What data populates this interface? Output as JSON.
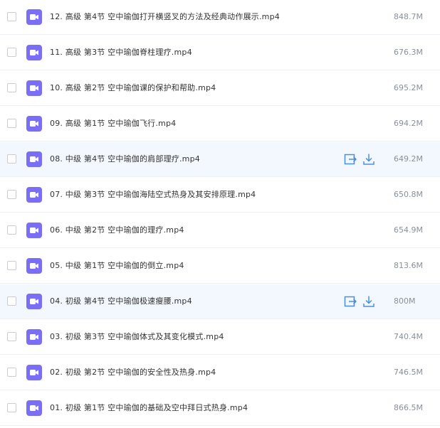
{
  "files": [
    {
      "name": "12. 高级 第4节 空中瑜伽打开横竖叉的方法及经典动作展示.mp4",
      "size": "848.7M",
      "hovered": false,
      "icon": "video-file-icon"
    },
    {
      "name": "11. 高级 第3节 空中瑜伽脊柱理疗.mp4",
      "size": "676.3M",
      "hovered": false,
      "icon": "video-file-icon"
    },
    {
      "name": "10. 高级 第2节 空中瑜伽课的保护和帮助.mp4",
      "size": "695.2M",
      "hovered": false,
      "icon": "video-file-icon"
    },
    {
      "name": "09. 高级 第1节 空中瑜伽飞行.mp4",
      "size": "694.2M",
      "hovered": false,
      "icon": "video-file-icon"
    },
    {
      "name": "08. 中级 第4节 空中瑜伽的肩部理疗.mp4",
      "size": "649.2M",
      "hovered": true,
      "icon": "video-file-icon"
    },
    {
      "name": "07. 中级 第3节 空中瑜伽海陆空式热身及其安排原理.mp4",
      "size": "650.8M",
      "hovered": false,
      "icon": "video-file-icon"
    },
    {
      "name": "06. 中级 第2节 空中瑜伽的理疗.mp4",
      "size": "654.9M",
      "hovered": false,
      "icon": "video-file-icon"
    },
    {
      "name": "05. 中级 第1节 空中瑜伽的倒立.mp4",
      "size": "813.6M",
      "hovered": false,
      "icon": "video-file-icon"
    },
    {
      "name": "04. 初级 第4节 空中瑜伽极速瘦腰.mp4",
      "size": "800M",
      "hovered": true,
      "icon": "video-file-icon"
    },
    {
      "name": "03. 初级 第3节 空中瑜伽体式及其变化模式.mp4",
      "size": "740.4M",
      "hovered": false,
      "icon": "video-file-icon"
    },
    {
      "name": "02. 初级 第2节 空中瑜伽的安全性及热身.mp4",
      "size": "746.5M",
      "hovered": false,
      "icon": "video-file-icon"
    },
    {
      "name": "01. 初级 第1节 空中瑜伽的基础及空中拜日式热身.mp4",
      "size": "866.5M",
      "hovered": false,
      "icon": "video-file-icon"
    }
  ],
  "colors": {
    "video_icon": "#7b6ef6",
    "action_icon": "#4a90e2",
    "hover_row": "#f3f8fe"
  },
  "action_icons": {
    "share": "share-icon",
    "download": "download-icon"
  }
}
